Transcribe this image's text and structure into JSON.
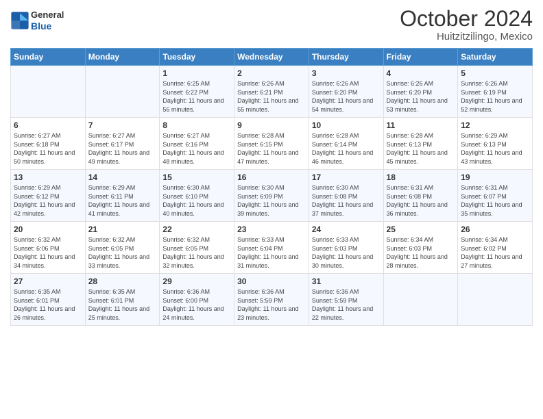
{
  "header": {
    "logo_general": "General",
    "logo_blue": "Blue",
    "month_title": "October 2024",
    "location": "Huitzitzilingo, Mexico"
  },
  "weekdays": [
    "Sunday",
    "Monday",
    "Tuesday",
    "Wednesday",
    "Thursday",
    "Friday",
    "Saturday"
  ],
  "weeks": [
    [
      {
        "day": "",
        "empty": true
      },
      {
        "day": "",
        "empty": true
      },
      {
        "day": "1",
        "sunrise": "6:25 AM",
        "sunset": "6:22 PM",
        "daylight": "11 hours and 56 minutes."
      },
      {
        "day": "2",
        "sunrise": "6:26 AM",
        "sunset": "6:21 PM",
        "daylight": "11 hours and 55 minutes."
      },
      {
        "day": "3",
        "sunrise": "6:26 AM",
        "sunset": "6:20 PM",
        "daylight": "11 hours and 54 minutes."
      },
      {
        "day": "4",
        "sunrise": "6:26 AM",
        "sunset": "6:20 PM",
        "daylight": "11 hours and 53 minutes."
      },
      {
        "day": "5",
        "sunrise": "6:26 AM",
        "sunset": "6:19 PM",
        "daylight": "11 hours and 52 minutes."
      }
    ],
    [
      {
        "day": "6",
        "sunrise": "6:27 AM",
        "sunset": "6:18 PM",
        "daylight": "11 hours and 50 minutes."
      },
      {
        "day": "7",
        "sunrise": "6:27 AM",
        "sunset": "6:17 PM",
        "daylight": "11 hours and 49 minutes."
      },
      {
        "day": "8",
        "sunrise": "6:27 AM",
        "sunset": "6:16 PM",
        "daylight": "11 hours and 48 minutes."
      },
      {
        "day": "9",
        "sunrise": "6:28 AM",
        "sunset": "6:15 PM",
        "daylight": "11 hours and 47 minutes."
      },
      {
        "day": "10",
        "sunrise": "6:28 AM",
        "sunset": "6:14 PM",
        "daylight": "11 hours and 46 minutes."
      },
      {
        "day": "11",
        "sunrise": "6:28 AM",
        "sunset": "6:13 PM",
        "daylight": "11 hours and 45 minutes."
      },
      {
        "day": "12",
        "sunrise": "6:29 AM",
        "sunset": "6:13 PM",
        "daylight": "11 hours and 43 minutes."
      }
    ],
    [
      {
        "day": "13",
        "sunrise": "6:29 AM",
        "sunset": "6:12 PM",
        "daylight": "11 hours and 42 minutes."
      },
      {
        "day": "14",
        "sunrise": "6:29 AM",
        "sunset": "6:11 PM",
        "daylight": "11 hours and 41 minutes."
      },
      {
        "day": "15",
        "sunrise": "6:30 AM",
        "sunset": "6:10 PM",
        "daylight": "11 hours and 40 minutes."
      },
      {
        "day": "16",
        "sunrise": "6:30 AM",
        "sunset": "6:09 PM",
        "daylight": "11 hours and 39 minutes."
      },
      {
        "day": "17",
        "sunrise": "6:30 AM",
        "sunset": "6:08 PM",
        "daylight": "11 hours and 37 minutes."
      },
      {
        "day": "18",
        "sunrise": "6:31 AM",
        "sunset": "6:08 PM",
        "daylight": "11 hours and 36 minutes."
      },
      {
        "day": "19",
        "sunrise": "6:31 AM",
        "sunset": "6:07 PM",
        "daylight": "11 hours and 35 minutes."
      }
    ],
    [
      {
        "day": "20",
        "sunrise": "6:32 AM",
        "sunset": "6:06 PM",
        "daylight": "11 hours and 34 minutes."
      },
      {
        "day": "21",
        "sunrise": "6:32 AM",
        "sunset": "6:05 PM",
        "daylight": "11 hours and 33 minutes."
      },
      {
        "day": "22",
        "sunrise": "6:32 AM",
        "sunset": "6:05 PM",
        "daylight": "11 hours and 32 minutes."
      },
      {
        "day": "23",
        "sunrise": "6:33 AM",
        "sunset": "6:04 PM",
        "daylight": "11 hours and 31 minutes."
      },
      {
        "day": "24",
        "sunrise": "6:33 AM",
        "sunset": "6:03 PM",
        "daylight": "11 hours and 30 minutes."
      },
      {
        "day": "25",
        "sunrise": "6:34 AM",
        "sunset": "6:03 PM",
        "daylight": "11 hours and 28 minutes."
      },
      {
        "day": "26",
        "sunrise": "6:34 AM",
        "sunset": "6:02 PM",
        "daylight": "11 hours and 27 minutes."
      }
    ],
    [
      {
        "day": "27",
        "sunrise": "6:35 AM",
        "sunset": "6:01 PM",
        "daylight": "11 hours and 26 minutes."
      },
      {
        "day": "28",
        "sunrise": "6:35 AM",
        "sunset": "6:01 PM",
        "daylight": "11 hours and 25 minutes."
      },
      {
        "day": "29",
        "sunrise": "6:36 AM",
        "sunset": "6:00 PM",
        "daylight": "11 hours and 24 minutes."
      },
      {
        "day": "30",
        "sunrise": "6:36 AM",
        "sunset": "5:59 PM",
        "daylight": "11 hours and 23 minutes."
      },
      {
        "day": "31",
        "sunrise": "6:36 AM",
        "sunset": "5:59 PM",
        "daylight": "11 hours and 22 minutes."
      },
      {
        "day": "",
        "empty": true
      },
      {
        "day": "",
        "empty": true
      }
    ]
  ],
  "labels": {
    "sunrise": "Sunrise:",
    "sunset": "Sunset:",
    "daylight": "Daylight:"
  }
}
